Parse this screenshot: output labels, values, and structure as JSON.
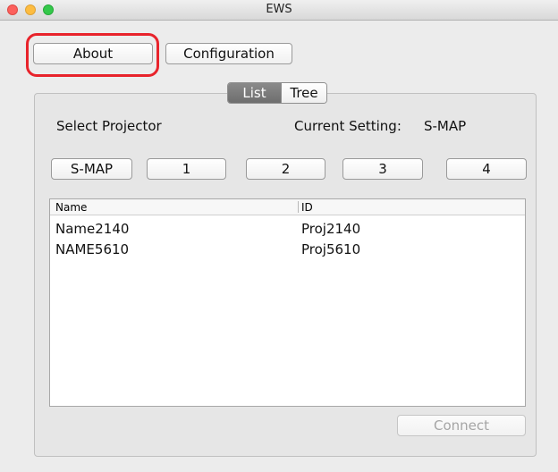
{
  "window": {
    "title": "EWS"
  },
  "toolbar": {
    "about_label": "About",
    "configuration_label": "Configuration"
  },
  "view_tabs": [
    {
      "label": "List",
      "selected": true
    },
    {
      "label": "Tree",
      "selected": false
    }
  ],
  "select_projector_label": "Select Projector",
  "current_setting": {
    "label": "Current Setting:",
    "value": "S-MAP"
  },
  "projector_buttons": [
    "S-MAP",
    "1",
    "2",
    "3",
    "4"
  ],
  "table": {
    "columns": [
      "Name",
      "ID"
    ],
    "rows": [
      {
        "name": "Name2140",
        "id": "Proj2140"
      },
      {
        "name": "NAME5610",
        "id": "Proj5610"
      }
    ]
  },
  "connect_label": "Connect",
  "colors": {
    "highlight": "#e8232b",
    "selected_tab": "#7c7c7c",
    "disabled_text": "#a5a5a5"
  }
}
